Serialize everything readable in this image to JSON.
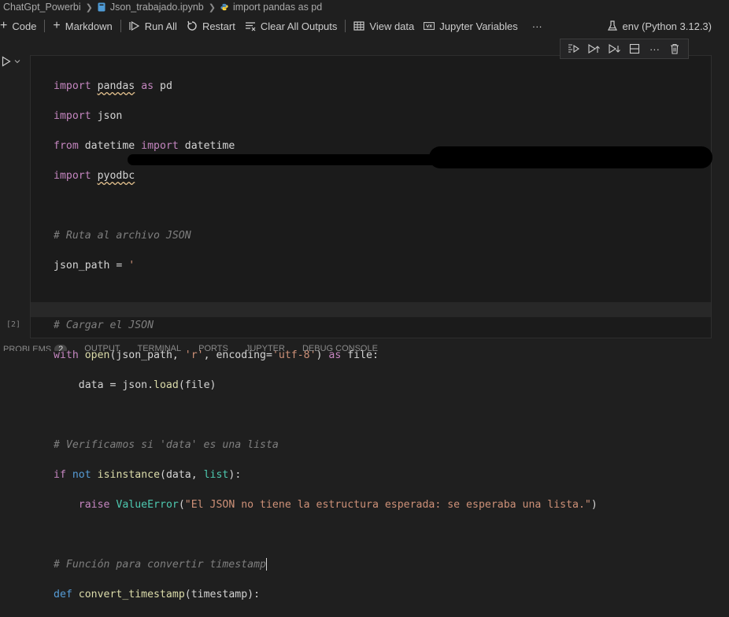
{
  "breadcrumb": {
    "folder": "ChatGpt_Powerbi",
    "file": "Json_trabajado.ipynb",
    "cell": "import pandas as pd"
  },
  "toolbar": {
    "code_label": "Code",
    "markdown_label": "Markdown",
    "run_all_label": "Run All",
    "restart_label": "Restart",
    "clear_outputs_label": "Clear All Outputs",
    "view_data_label": "View data",
    "jupyter_variables_label": "Jupyter Variables",
    "more_label": "···",
    "kernel_label": "env (Python 3.12.3)"
  },
  "cell": {
    "execution_count": "[2]",
    "more_label": "···"
  },
  "code_lines": [
    "import pandas as pd",
    "import json",
    "from datetime import datetime",
    "import pyodbc",
    "",
    "# Ruta al archivo JSON",
    "json_path = '",
    "",
    "# Cargar el JSON",
    "with open(json_path, 'r', encoding='utf-8') as file:",
    "    data = json.load(file)",
    "",
    "# Verificamos si 'data' es una lista",
    "if not isinstance(data, list):",
    "    raise ValueError(\"El JSON no tiene la estructura esperada: se esperaba una lista.\")",
    "",
    "# Función para convertir timestamp",
    "def convert_timestamp(timestamp):"
  ],
  "panel": {
    "problems": "PROBLEMS",
    "problems_count": "2",
    "output": "OUTPUT",
    "terminal": "TERMINAL",
    "ports": "PORTS",
    "jupyter": "JUPYTER",
    "debug_console": "DEBUG CONSOLE"
  }
}
